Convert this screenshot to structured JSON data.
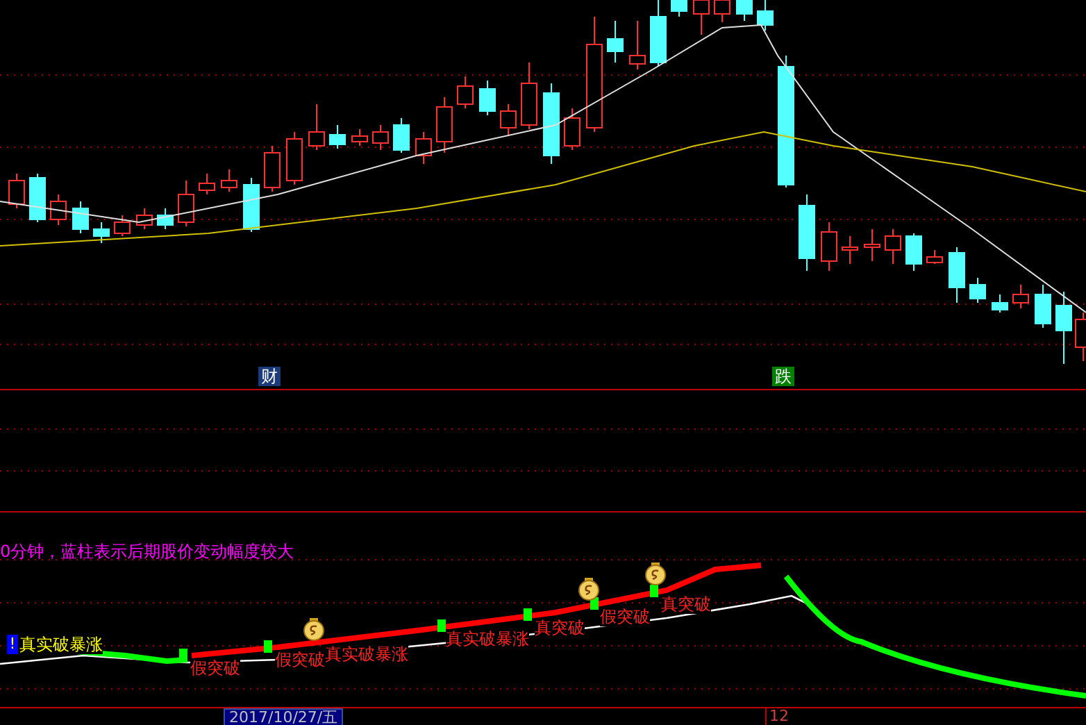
{
  "price_panel": {
    "markers": [
      {
        "text": "财",
        "kind": "news"
      },
      {
        "text": "跌",
        "kind": "fall"
      }
    ]
  },
  "indicator_panel": {
    "description": "0分钟，蓝柱表示后期股价变动幅度较大",
    "signals": [
      {
        "text": "真实破暴涨",
        "kind": "strong",
        "badge": "!"
      },
      {
        "text": "假突破",
        "kind": "false"
      },
      {
        "text": "假突破",
        "kind": "false"
      },
      {
        "text": "真实破暴涨",
        "kind": "true"
      },
      {
        "text": "真实破暴涨",
        "kind": "true"
      },
      {
        "text": "真突破",
        "kind": "true"
      },
      {
        "text": "假突破",
        "kind": "false"
      },
      {
        "text": "真突破",
        "kind": "true"
      }
    ]
  },
  "time_axis": {
    "date": "2017/10/27/五",
    "label": "12"
  }
}
